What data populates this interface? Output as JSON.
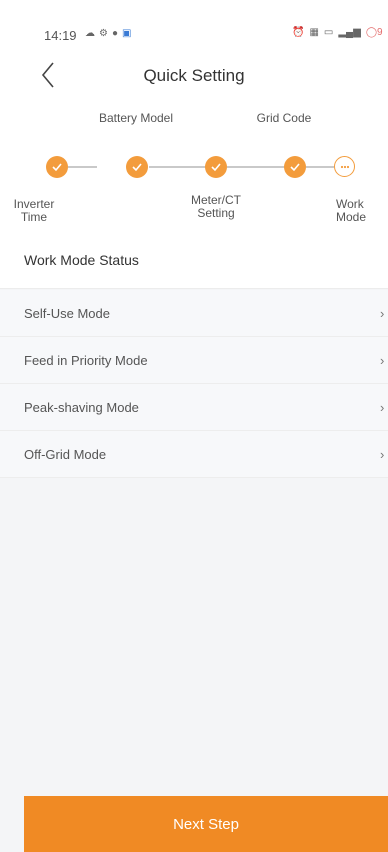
{
  "status_bar": {
    "time": "14:19",
    "right_text": "Ⓝ ",
    "battery": "9"
  },
  "header": {
    "title": "Quick Setting"
  },
  "steps": [
    {
      "label": "Inverter Time",
      "state": "done"
    },
    {
      "label": "Battery Model",
      "state": "done"
    },
    {
      "label": "Meter/CT Setting",
      "state": "done"
    },
    {
      "label": "Grid Code",
      "state": "done"
    },
    {
      "label": "Work Mode",
      "state": "current"
    }
  ],
  "status_row": {
    "label": "Work Mode Status"
  },
  "modes": [
    {
      "label": "Self-Use Mode"
    },
    {
      "label": "Feed in Priority Mode"
    },
    {
      "label": "Peak-shaving Mode"
    },
    {
      "label": "Off-Grid Mode"
    }
  ],
  "footer": {
    "next_label": "Next Step"
  },
  "colors": {
    "accent": "#f08a24",
    "dot": "#f39c3c"
  }
}
